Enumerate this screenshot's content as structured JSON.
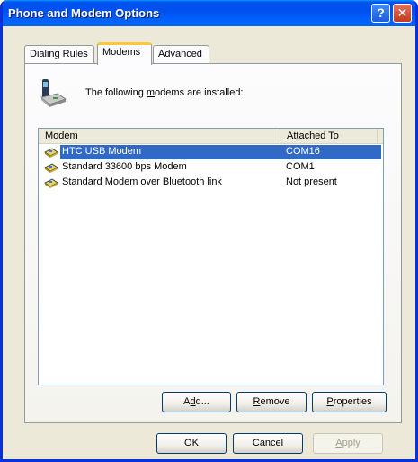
{
  "window": {
    "title": "Phone and Modem Options",
    "help_glyph": "?",
    "close_glyph": "✕"
  },
  "tabs": [
    {
      "label": "Dialing Rules",
      "active": false
    },
    {
      "label": "Modems",
      "active": true
    },
    {
      "label": "Advanced",
      "active": false
    }
  ],
  "modems_page": {
    "installed_label": {
      "pre": "The following ",
      "accel": "m",
      "post": "odems are  installed:"
    },
    "columns": [
      "Modem",
      "Attached To"
    ],
    "rows": [
      {
        "name": "HTC USB Modem",
        "attached_to": "COM16",
        "selected": true,
        "icon": "modem-icon"
      },
      {
        "name": "Standard 33600 bps Modem",
        "attached_to": "COM1",
        "selected": false,
        "icon": "modem-icon"
      },
      {
        "name": "Standard Modem over Bluetooth link",
        "attached_to": "Not present",
        "selected": false,
        "icon": "modem-icon"
      }
    ],
    "buttons": {
      "add": {
        "pre": "A",
        "accel": "d",
        "post": "d..."
      },
      "remove": {
        "pre": "",
        "accel": "R",
        "post": "emove"
      },
      "properties": {
        "pre": "",
        "accel": "P",
        "post": "roperties"
      }
    }
  },
  "dialog_buttons": {
    "ok": "OK",
    "cancel": "Cancel",
    "apply": {
      "pre": "",
      "accel": "A",
      "post": "pply",
      "enabled": false
    }
  },
  "colors": {
    "titlebar": "#0054e3",
    "selection": "#316ac5",
    "dialog_bg": "#ece9d8"
  }
}
